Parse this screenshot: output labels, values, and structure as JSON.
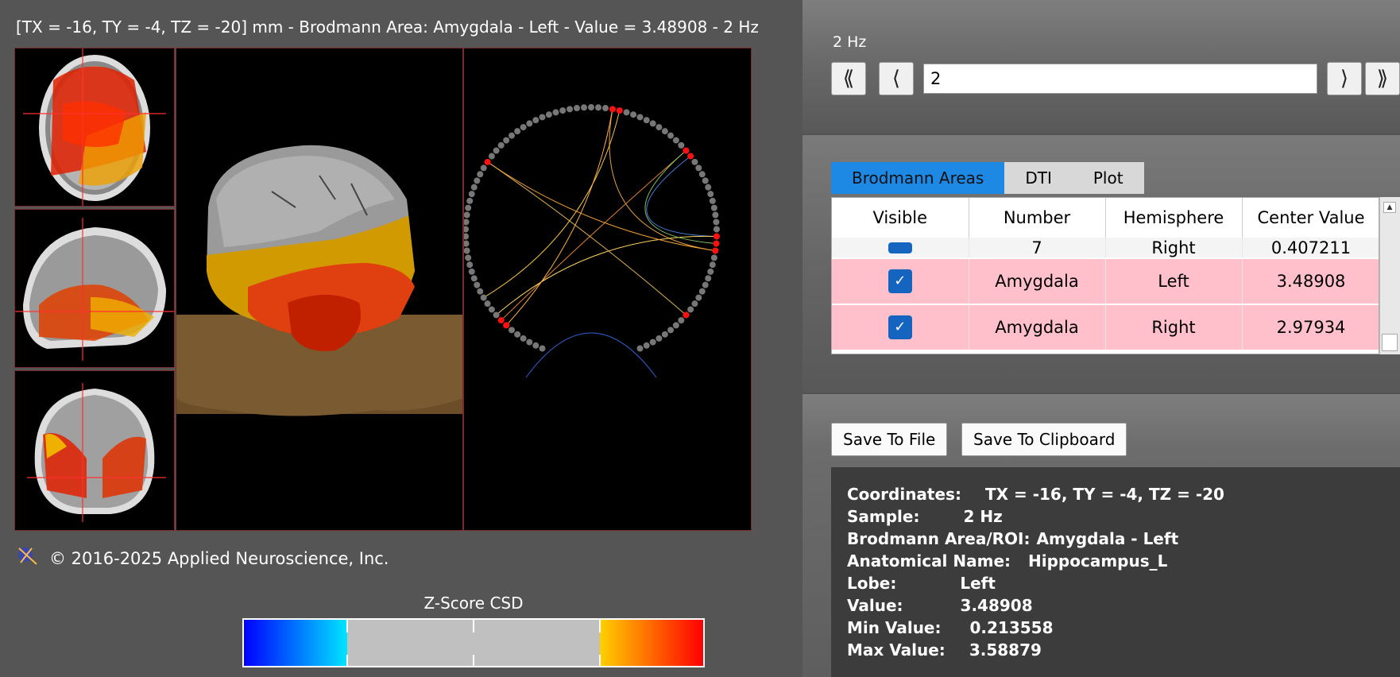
{
  "header": {
    "status": "[TX = -16, TY = -4, TZ = -20] mm - Brodmann Area: Amygdala - Left - Value = 3.48908 - 2 Hz"
  },
  "footer": {
    "copyright": "© 2016-2025 Applied Neuroscience, Inc."
  },
  "colorbar": {
    "title": "Z-Score CSD",
    "colors": {
      "low": "#0000ff",
      "low_mid": "#00e5ff",
      "mid": "#c0c0c0",
      "high_mid": "#ffd000",
      "high": "#ff0000"
    }
  },
  "freq": {
    "label": "2 Hz",
    "value": "2",
    "first_icon": "double-chevron-left-icon",
    "prev_icon": "chevron-left-icon",
    "next_icon": "chevron-right-icon",
    "last_icon": "double-chevron-right-icon"
  },
  "tabs": [
    {
      "label": "Brodmann Areas",
      "active": true
    },
    {
      "label": "DTI",
      "active": false
    },
    {
      "label": "Plot",
      "active": false
    }
  ],
  "table": {
    "headers": [
      "Visible",
      "Number",
      "Hemisphere",
      "Center Value"
    ],
    "partial_row": {
      "number": "7",
      "hemisphere": "Right",
      "value": "0.407211"
    },
    "rows": [
      {
        "number": "Amygdala",
        "hemisphere": "Left",
        "value": "3.48908",
        "checked": true
      },
      {
        "number": "Amygdala",
        "hemisphere": "Right",
        "value": "2.97934",
        "checked": true
      }
    ]
  },
  "buttons": {
    "save_file": "Save To File",
    "save_clip": "Save To Clipboard"
  },
  "info": {
    "coords_label": "Coordinates:",
    "coords_value": "TX = -16, TY = -4, TZ = -20",
    "sample_label": "Sample:",
    "sample_value": "2 Hz",
    "ba_label": "Brodmann Area/ROI:",
    "ba_value": "Amygdala - Left",
    "anat_label": "Anatomical Name:",
    "anat_value": "Hippocampus_L",
    "lobe_label": "Lobe:",
    "lobe_value": "Left",
    "value_label": "Value:",
    "value_value": "3.48908",
    "min_label": "Min Value:",
    "min_value": "0.213558",
    "max_label": "Max Value:",
    "max_value": "3.58879"
  }
}
